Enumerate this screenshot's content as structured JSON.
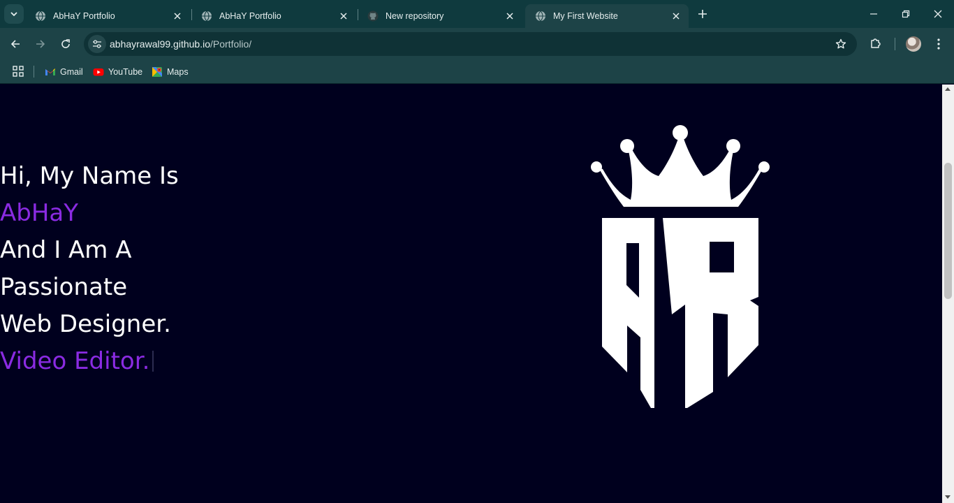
{
  "tabs": [
    {
      "title": "AbHaY Portfolio",
      "icon": "globe-icon",
      "active": false
    },
    {
      "title": "AbHaY Portfolio",
      "icon": "globe-icon",
      "active": false
    },
    {
      "title": "New repository",
      "icon": "github-icon",
      "active": false
    },
    {
      "title": "My First Website",
      "icon": "globe-icon",
      "active": true
    }
  ],
  "address_bar": {
    "host": "abhayrawal99.github.io",
    "path": "/Portfolio/"
  },
  "bookmarks": [
    {
      "label": "Gmail",
      "icon": "gmail-icon"
    },
    {
      "label": "YouTube",
      "icon": "youtube-icon"
    },
    {
      "label": "Maps",
      "icon": "maps-icon"
    }
  ],
  "hero": {
    "line1": "Hi, My Name Is",
    "name": "AbHaY",
    "line3": "And I Am A",
    "line4": "Passionate",
    "line5": "Web Designer.",
    "typed": "Video Editor."
  },
  "logo": {
    "alt": "AR crown logo",
    "icon": "crown-ar-logo"
  },
  "colors": {
    "accent": "#8a2be2",
    "page_bg": "#00001e",
    "chrome": "#1d4347",
    "tabstrip": "#0f3a3e"
  }
}
